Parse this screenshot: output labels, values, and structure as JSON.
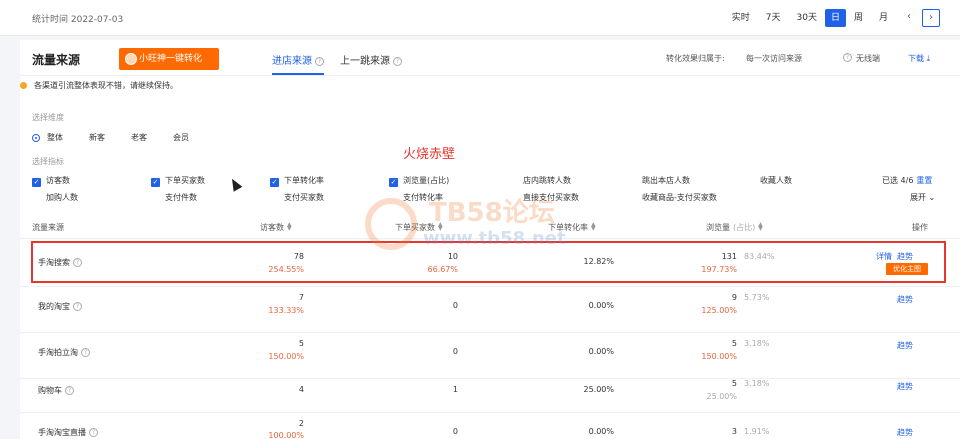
{
  "topbar": {
    "stat_time": "统计时间 2022-07-03",
    "periods": [
      "实时",
      "7天",
      "30天",
      "日",
      "周",
      "月"
    ],
    "active_period": "日",
    "prev": "‹",
    "next": "›"
  },
  "panel": {
    "title": "流量来源",
    "promo_button": "小旺神一键转化",
    "tabs": [
      "进店来源",
      "上一跳来源"
    ],
    "conversion_label": "转化效果归属于:",
    "conversion_value": "每一次访问来源",
    "wireless": "无线端",
    "download": "下载"
  },
  "notice": "各渠道引流整体表现不错，请继续保持。",
  "dimension": {
    "label": "选择维度",
    "options": [
      "整体",
      "新客",
      "老客",
      "会员"
    ],
    "selected": "整体"
  },
  "metrics": {
    "label": "选择指标",
    "row1": [
      {
        "label": "访客数",
        "checked": true
      },
      {
        "label": "下单买家数",
        "checked": true
      },
      {
        "label": "下单转化率",
        "checked": true
      },
      {
        "label": "浏览量(占比)",
        "checked": true
      },
      {
        "label": "店内跳转人数",
        "checked": false
      },
      {
        "label": "跳出本店人数",
        "checked": false
      },
      {
        "label": "收藏人数",
        "checked": false
      }
    ],
    "row2": [
      "加购人数",
      "支付件数",
      "支付买家数",
      "支付转化率",
      "直接支付买家数",
      "收藏商品-支付买家数"
    ],
    "selected_count": "已选 4/6",
    "reset": "重置",
    "expand": "展开"
  },
  "red_watermark": "火烧赤壁",
  "watermark": {
    "site": "TB58论坛",
    "url": "www.tb58.net"
  },
  "table": {
    "headers": {
      "source": "流量来源",
      "visitors": "访客数",
      "buyers": "下单买家数",
      "rate": "下单转化率",
      "views": "浏览量",
      "share": "(占比)",
      "action": "操作"
    },
    "rows": [
      {
        "source": "手淘搜索",
        "visitors": "78",
        "visitors_pct": "254.55%",
        "buyers": "10",
        "buyers_pct": "66.67%",
        "rate": "12.82%",
        "views": "131",
        "share": "83.44%",
        "views_pct": "197.73%",
        "actions": [
          "详情",
          "趋势"
        ],
        "badge": "优化主图"
      },
      {
        "source": "我的淘宝",
        "visitors": "7",
        "visitors_pct": "133.33%",
        "buyers": "0",
        "buyers_pct": "",
        "rate": "0.00%",
        "views": "9",
        "share": "5.73%",
        "views_pct": "125.00%",
        "actions": [
          "趋势"
        ]
      },
      {
        "source": "手淘拍立淘",
        "visitors": "5",
        "visitors_pct": "150.00%",
        "buyers": "0",
        "buyers_pct": "",
        "rate": "0.00%",
        "views": "5",
        "share": "3.18%",
        "views_pct": "150.00%",
        "actions": [
          "趋势"
        ]
      },
      {
        "source": "购物车",
        "visitors": "4",
        "visitors_pct": "",
        "buyers": "1",
        "buyers_pct": "",
        "rate": "25.00%",
        "views": "5",
        "share": "3.18%",
        "views_pct": "25.00%",
        "actions": [
          "趋势"
        ]
      },
      {
        "source": "手淘淘宝直播",
        "visitors": "2",
        "visitors_pct": "100.00%",
        "buyers": "0",
        "buyers_pct": "",
        "rate": "0.00%",
        "views": "3",
        "share": "1.91%",
        "views_pct": "",
        "actions": [
          "趋势"
        ]
      }
    ]
  }
}
